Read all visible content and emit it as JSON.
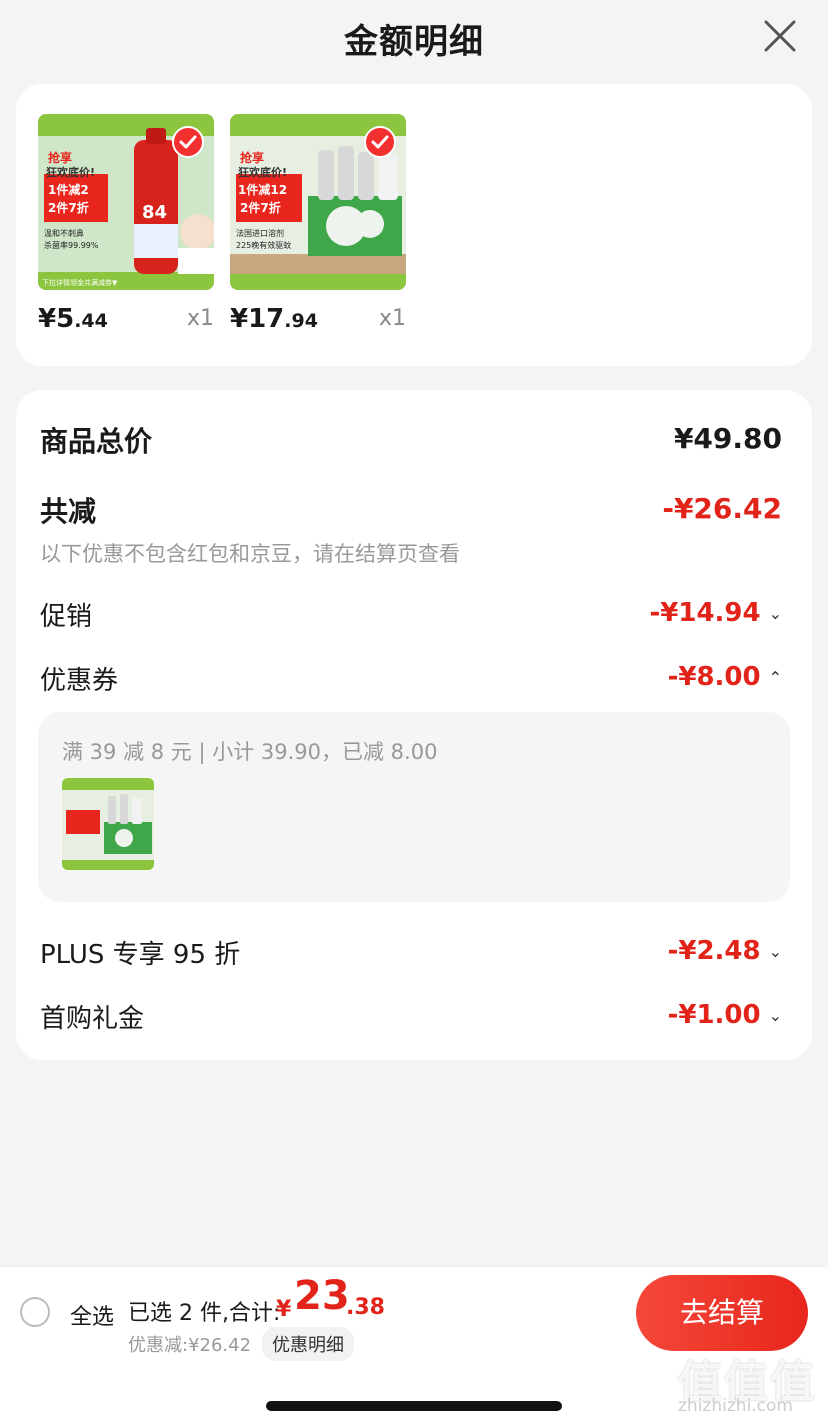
{
  "header": {
    "title": "金额明细"
  },
  "products": [
    {
      "price_int": "¥5",
      "price_dec": ".44",
      "qty": "x1",
      "thumb_texts": [
        "抢享",
        "狂欢底价!",
        "1件减2",
        "2件7折",
        "温和不刺鼻",
        "杀菌率99.99%",
        "84",
        "下拉详情领金共满减券▼"
      ]
    },
    {
      "price_int": "¥17",
      "price_dec": ".94",
      "qty": "x1",
      "thumb_texts": [
        "抢享",
        "狂欢底价!",
        "1件减12",
        "2件7折",
        "法国进口溶剂",
        "225晚有效驱蚊"
      ]
    }
  ],
  "summary": {
    "total_label": "商品总价",
    "total_value": "¥49.80",
    "reduce_label": "共减",
    "reduce_value": "-¥26.42",
    "note": "以下优惠不包含红包和京豆，请在结算页查看",
    "promo_label": "促销",
    "promo_value": "-¥14.94",
    "coupon_label": "优惠券",
    "coupon_value": "-¥8.00",
    "coupon_detail": "满 39 减 8 元 | 小计 39.90，已减 8.00",
    "plus_label": "PLUS 专享 95 折",
    "plus_value": "-¥2.48",
    "first_label": "首购礼金",
    "first_value": "-¥1.00"
  },
  "bottom": {
    "select_all": "全选",
    "selected_text": "已选 2 件,合计:",
    "currency": "¥",
    "total_int": "23",
    "total_dec": ".38",
    "discount": "优惠减:¥26.42",
    "detail_chip": "优惠明细",
    "checkout": "去结算"
  },
  "watermark": {
    "big": "值值值",
    "small": "zhizhizhi.com"
  },
  "icons": {
    "close": "close-icon",
    "check": "check-icon",
    "chevron_down": "chevron-down-icon",
    "chevron_up": "chevron-up-icon",
    "radio": "radio-icon"
  },
  "colors": {
    "accent_red": "#e2231a",
    "card_bg": "#ffffff",
    "page_bg": "#f4f4f4"
  }
}
